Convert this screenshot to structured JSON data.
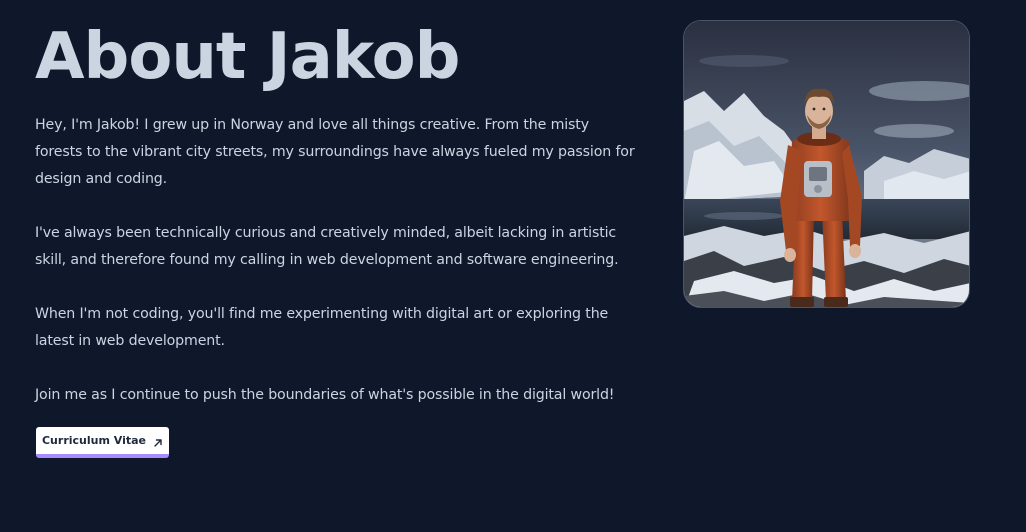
{
  "about": {
    "title": "About Jakob",
    "paragraphs": [
      "Hey, I'm Jakob! I grew up in Norway and love all things creative. From the misty forests to the vibrant city streets, my surroundings have always fueled my passion for design and coding.",
      "I've always been technically curious and creatively minded, albeit lacking in artistic skill, and therefore found my calling in web development and software engineering.",
      "When I'm not coding, you'll find me experimenting with digital art or exploring the latest in web development.",
      "Join me as I continue to push the boundaries of what's possible in the digital world!"
    ],
    "cv_button": {
      "label": "Curriculum Vitae",
      "icon": "arrow-up-right-icon"
    }
  },
  "portrait": {
    "description_icon": "portrait-image"
  },
  "colors": {
    "background": "#0f172a",
    "text": "#cbd5e1",
    "button_bg": "#ffffff",
    "button_accent": "#a78bfa"
  }
}
